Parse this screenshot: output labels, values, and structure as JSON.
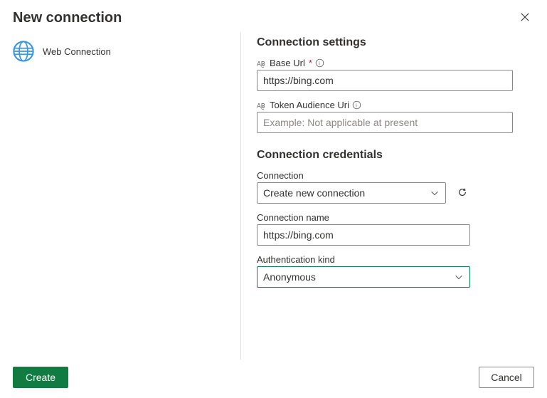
{
  "title": "New connection",
  "left_item": {
    "label": "Web Connection"
  },
  "settings": {
    "heading": "Connection settings",
    "base_url": {
      "label": "Base Url",
      "value": "https://bing.com"
    },
    "token_audience": {
      "label": "Token Audience Uri",
      "placeholder": "Example: Not applicable at present"
    }
  },
  "credentials": {
    "heading": "Connection credentials",
    "connection": {
      "label": "Connection",
      "value": "Create new connection"
    },
    "connection_name": {
      "label": "Connection name",
      "value": "https://bing.com"
    },
    "auth_kind": {
      "label": "Authentication kind",
      "value": "Anonymous"
    }
  },
  "buttons": {
    "create": "Create",
    "cancel": "Cancel"
  }
}
